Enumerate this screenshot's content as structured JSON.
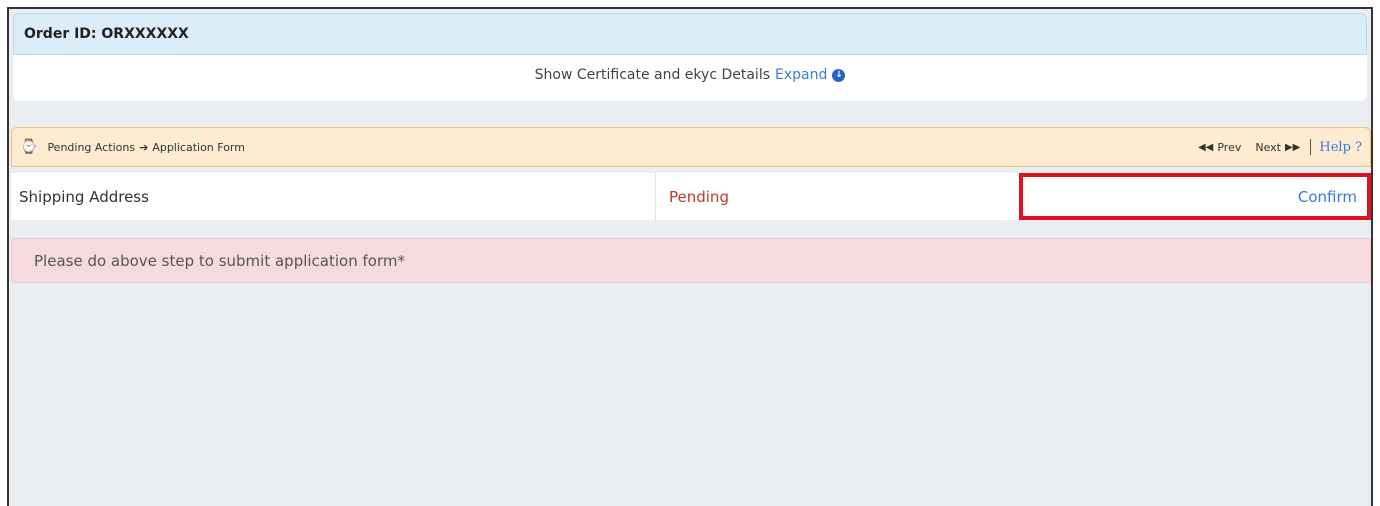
{
  "order": {
    "label": "Order ID: ORXXXXXX",
    "certificate_text": "Show Certificate and ekyc Details",
    "expand_label": "Expand",
    "expand_icon": "arrow-circle-down-icon"
  },
  "actions_bar": {
    "icon": "clock-icon",
    "breadcrumb_root": "Pending Actions",
    "breadcrumb_current": "Application Form",
    "prev_label": "Prev",
    "next_label": "Next",
    "help_label": "Help ?"
  },
  "steps": [
    {
      "name": "Shipping Address",
      "status": "Pending",
      "action": "Confirm"
    }
  ],
  "alert": {
    "message": "Please do above step to submit application form*"
  },
  "colors": {
    "header_bg": "#dbedf8",
    "actions_bg": "#fdecd2",
    "pending": "#c0392b",
    "link": "#3a7bd5",
    "highlight_border": "#e0121f",
    "alert_bg": "#f6dbde"
  }
}
